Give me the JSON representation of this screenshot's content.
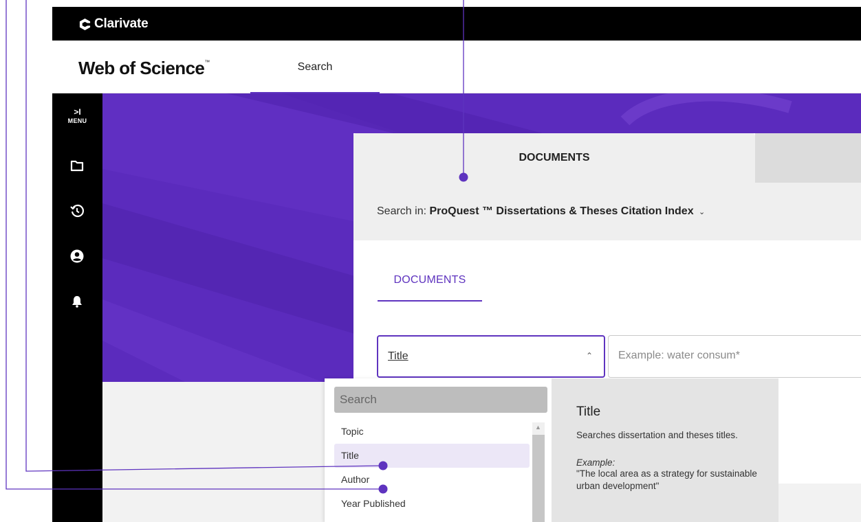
{
  "brand": {
    "name": "Clarivate"
  },
  "product": {
    "name": "Web of Science",
    "trademark": "™"
  },
  "nav": {
    "search_label": "Search"
  },
  "side_menu": {
    "toggle_arrow": ">I",
    "toggle_label": "MENU"
  },
  "card": {
    "tab_label": "DOCUMENTS",
    "search_in_label": "Search in:",
    "search_in_value": "ProQuest ™ Dissertations & Theses Citation Index",
    "subtab_label": "DOCUMENTS",
    "field_value": "Title",
    "query_placeholder": "Example: water consum*"
  },
  "dropdown": {
    "search_placeholder": "Search",
    "items": [
      "Topic",
      "Title",
      "Author",
      "Year Published"
    ],
    "selected": "Title"
  },
  "help": {
    "title": "Title",
    "description": "Searches dissertation and theses titles.",
    "example_label": "Example:",
    "example_text": "\"The local area as a strategy for sustainable urban development\""
  },
  "colors": {
    "accent": "#5e33bf",
    "hero": "#5b2bbd",
    "topbar": "#000000"
  }
}
